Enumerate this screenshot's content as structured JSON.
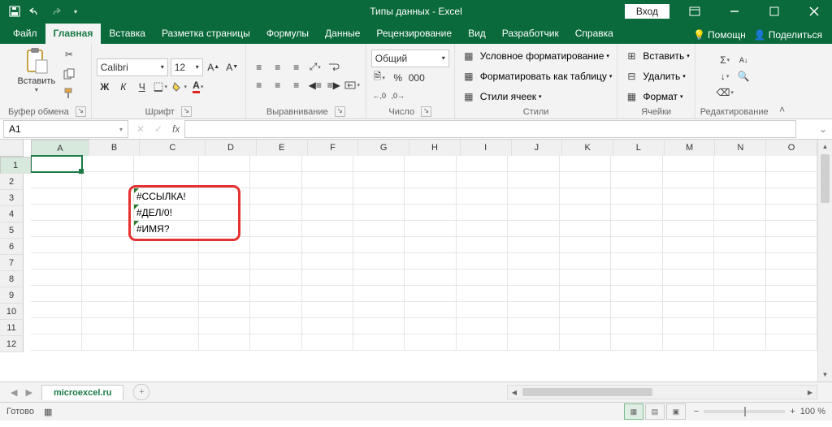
{
  "title": "Типы данных  -  Excel",
  "signin": "Вход",
  "tabs": {
    "file": "Файл",
    "home": "Главная",
    "insert": "Вставка",
    "layout": "Разметка страницы",
    "formulas": "Формулы",
    "data": "Данные",
    "review": "Рецензирование",
    "view": "Вид",
    "developer": "Разработчик",
    "help": "Справка",
    "tellme": "Помощн",
    "share": "Поделиться"
  },
  "ribbon": {
    "clipboard": {
      "paste": "Вставить",
      "label": "Буфер обмена"
    },
    "font": {
      "name": "Calibri",
      "size": "12",
      "label": "Шрифт"
    },
    "align": {
      "label": "Выравнивание"
    },
    "number": {
      "format": "Общий",
      "label": "Число"
    },
    "styles": {
      "cond": "Условное форматирование",
      "table": "Форматировать как таблицу",
      "cell": "Стили ячеек",
      "label": "Стили"
    },
    "cells": {
      "insert": "Вставить",
      "delete": "Удалить",
      "format": "Формат",
      "label": "Ячейки"
    },
    "editing": {
      "label": "Редактирование"
    }
  },
  "namebox": "A1",
  "columns": [
    "A",
    "B",
    "C",
    "D",
    "E",
    "F",
    "G",
    "H",
    "I",
    "J",
    "K",
    "L",
    "M",
    "N",
    "O"
  ],
  "rows": [
    "1",
    "2",
    "3",
    "4",
    "5",
    "6",
    "7",
    "8",
    "9",
    "10",
    "11",
    "12"
  ],
  "errors": {
    "c3": "#ССЫЛКА!",
    "c4": "#ДЕЛ/0!",
    "c5": "#ИМЯ?"
  },
  "sheet_tab": "microexcel.ru",
  "status": "Готово",
  "zoom": "100 %"
}
